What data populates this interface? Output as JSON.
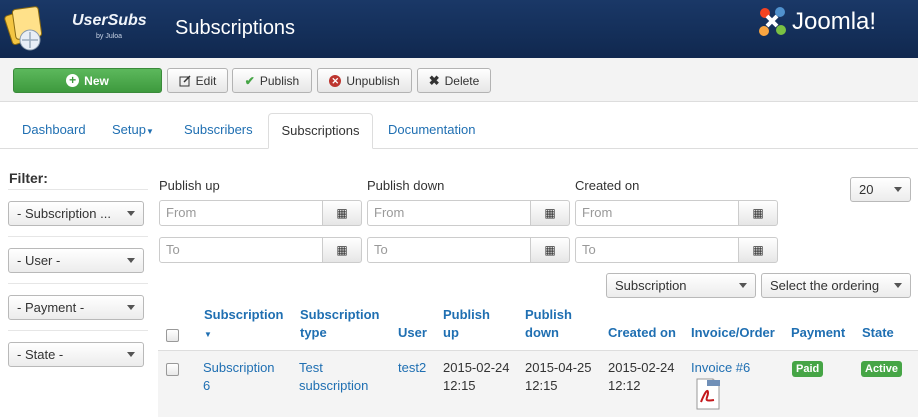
{
  "header": {
    "brand_name": "UserSubs",
    "brand_sub": "by Juloa",
    "title": "Subscriptions",
    "joomla_logo_text": "Joomla!",
    "colors": {
      "bar": "#1a3867",
      "accent": "#1f6fb2",
      "success": "#46a546"
    }
  },
  "toolbar": {
    "new_label": "New",
    "edit_label": "Edit",
    "publish_label": "Publish",
    "unpublish_label": "Unpublish",
    "delete_label": "Delete"
  },
  "tabs": {
    "dashboard": "Dashboard",
    "setup": "Setup",
    "subscribers": "Subscribers",
    "subscriptions": "Subscriptions",
    "documentation": "Documentation"
  },
  "filter": {
    "title": "Filter:",
    "subscription": "- Subscription ...",
    "user": "- User -",
    "payment": "- Payment -",
    "state": "- State -"
  },
  "dates": {
    "publish_up_label": "Publish up",
    "publish_down_label": "Publish down",
    "created_on_label": "Created on",
    "from_placeholder": "From",
    "to_placeholder": "To"
  },
  "list": {
    "limit": "20",
    "sort_field": "Subscription",
    "ordering": "Select the ordering"
  },
  "table": {
    "headers": {
      "subscription": "Subscription",
      "type_line1": "Subscription",
      "type_line2": "type",
      "user": "User",
      "pub_up_line1": "Publish",
      "pub_up_line2": "up",
      "pub_down_line1": "Publish",
      "pub_down_line2": "down",
      "created": "Created on",
      "invoice": "Invoice/Order",
      "payment": "Payment",
      "state": "State"
    },
    "rows": [
      {
        "sub_line1": "Subscription",
        "sub_line2": "6",
        "type_line1": "Test",
        "type_line2": "subscription",
        "user": "test2",
        "pub_up_date": "2015-02-24",
        "pub_up_time": "12:15",
        "pub_down_date": "2015-04-25",
        "pub_down_time": "12:15",
        "created_date": "2015-02-24",
        "created_time": "12:12",
        "invoice": "Invoice #6",
        "payment": "Paid",
        "state": "Active"
      }
    ]
  }
}
